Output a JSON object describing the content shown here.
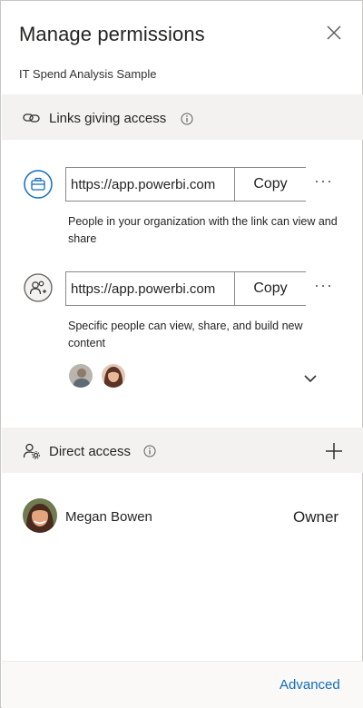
{
  "header": {
    "title": "Manage permissions",
    "subtitle": "IT Spend Analysis Sample"
  },
  "links_section": {
    "title": "Links giving access",
    "links": [
      {
        "icon": "briefcase-icon",
        "url": "https://app.powerbi.com",
        "copy_label": "Copy",
        "description": "People in your organization with the link can view and share"
      },
      {
        "icon": "people-add-icon",
        "url": "https://app.powerbi.com",
        "copy_label": "Copy",
        "description": "Specific people can view, share, and build new content"
      }
    ]
  },
  "direct_access": {
    "title": "Direct access",
    "people": [
      {
        "name": "Megan Bowen",
        "role": "Owner"
      }
    ]
  },
  "footer": {
    "advanced_label": "Advanced"
  },
  "colors": {
    "accent": "#0f6cbd",
    "section_bg": "#f3f2f1",
    "border": "#8a8886"
  }
}
